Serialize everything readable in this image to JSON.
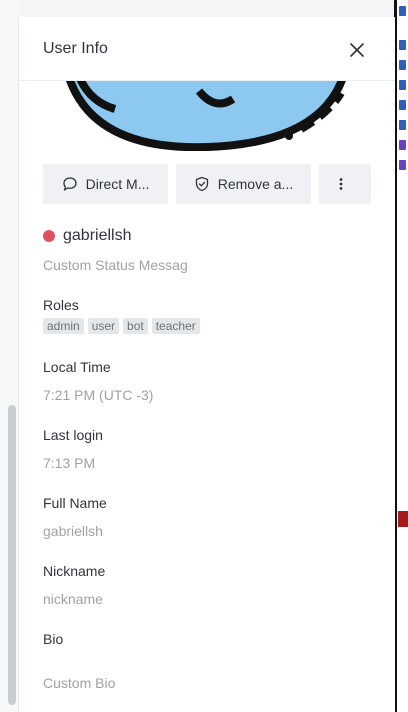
{
  "panel": {
    "title": "User Info"
  },
  "actions": {
    "direct_message": "Direct M...",
    "remove": "Remove a...",
    "more": "more options"
  },
  "user": {
    "username": "gabriellsh",
    "status_color": "#e0515f",
    "custom_status": "Custom Status Messag"
  },
  "fields": {
    "roles_label": "Roles",
    "roles": [
      "admin",
      "user",
      "bot",
      "teacher"
    ],
    "local_time_label": "Local Time",
    "local_time": "7:21 PM (UTC -3)",
    "last_login_label": "Last login",
    "last_login": "7:13 PM",
    "full_name_label": "Full Name",
    "full_name": "gabriellsh",
    "nickname_label": "Nickname",
    "nickname": "nickname",
    "bio_label": "Bio",
    "bio": "Custom Bio"
  },
  "colors": {
    "panel_bg": "#ffffff",
    "button_bg": "#eff1f4",
    "text_primary": "#2f343d",
    "text_muted": "#9ea2a8",
    "avatar_blue": "#8cc8ef"
  },
  "icons": [
    "close-icon",
    "chat-bubble-icon",
    "shield-icon",
    "kebab-menu-icon"
  ]
}
